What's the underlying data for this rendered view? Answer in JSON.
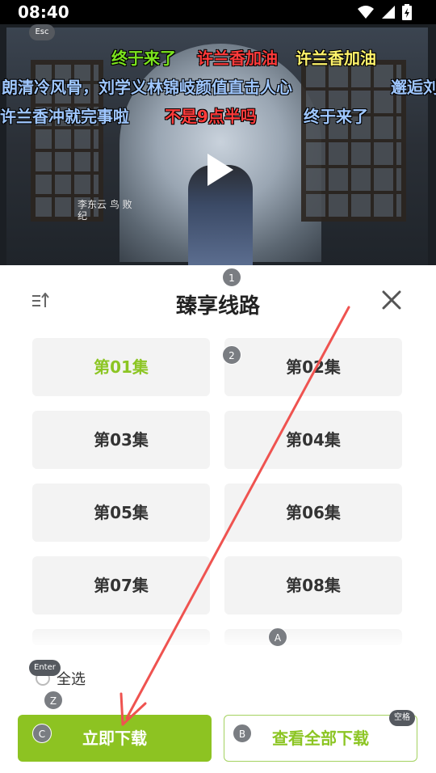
{
  "status": {
    "time": "08:40"
  },
  "badges": {
    "esc": "Esc",
    "b1": "1",
    "b2": "2",
    "ba": "A",
    "enter": "Enter",
    "bz": "Z",
    "bc": "C",
    "bb": "B",
    "space": "空格"
  },
  "video": {
    "danmaku": [
      {
        "text": "终于来了",
        "color": "#7be31e"
      },
      {
        "text": "许兰香加油",
        "color": "#ff3b3b"
      },
      {
        "text": "许兰香加油",
        "color": "#fff36b"
      },
      {
        "text": "朗清冷风骨，刘学义林锦岐颜值直击人心",
        "color": "#9fc7ff"
      },
      {
        "text": "邂逅刘",
        "color": "#9fc7ff"
      },
      {
        "text": "许兰香冲就完事啦",
        "color": "#9fc7ff"
      },
      {
        "text": "不是9点半吗",
        "color": "#ff3b3b"
      },
      {
        "text": "终于来了",
        "color": "#9fc7ff"
      }
    ],
    "seal_text": "李东云 鸟 败 纪"
  },
  "sheet": {
    "title": "臻享线路",
    "episodes": [
      "第01集",
      "第02集",
      "第03集",
      "第04集",
      "第05集",
      "第06集",
      "第07集",
      "第08集"
    ],
    "active_episode_index": 0,
    "select_all_label": "全选",
    "download_now_label": "立即下载",
    "view_all_label": "查看全部下载"
  },
  "colors": {
    "accent": "#8dc322",
    "arrow": "#ef5350"
  }
}
